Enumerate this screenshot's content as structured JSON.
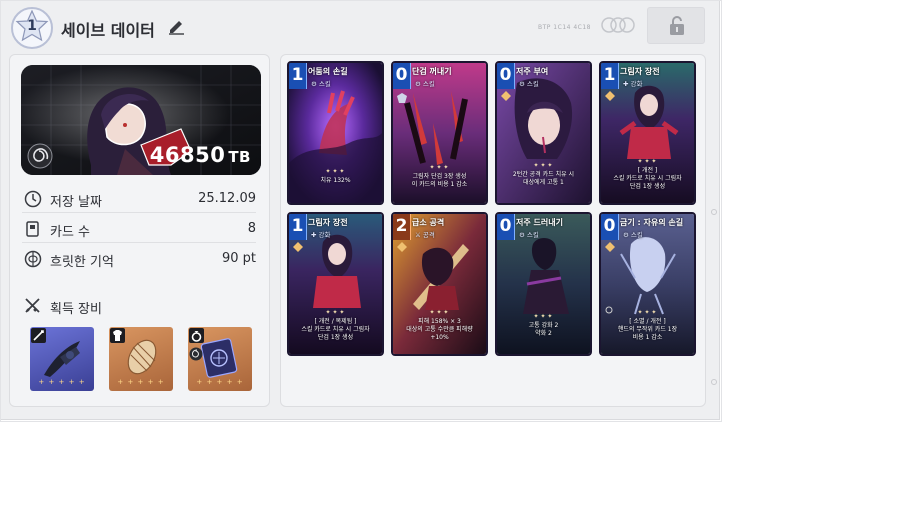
{
  "header": {
    "slot_number": "1",
    "title": "세이브 데이터",
    "faint_text": "BTP 1C14 4C18"
  },
  "profile": {
    "score": "46850",
    "score_unit": "TB",
    "stats": [
      {
        "label": "저장 날짜",
        "value": "25.12.09",
        "icon": "clock-icon"
      },
      {
        "label": "카드 수",
        "value": "8",
        "icon": "card-icon"
      },
      {
        "label": "흐릿한 기억",
        "value": "90 pt",
        "icon": "memory-icon"
      }
    ],
    "equipment_title": "획득 장비",
    "equipment": [
      {
        "name": "weapon",
        "icon": "sword-icon",
        "stars": "+ + + + +",
        "color": "#5b5fc7"
      },
      {
        "name": "armor",
        "icon": "shirt-icon",
        "stars": "+ + + + +",
        "color": "#c8814c"
      },
      {
        "name": "ring",
        "icon": "ring-icon",
        "stars": "+ + + + +",
        "color": "#c8814c"
      }
    ]
  },
  "cards": [
    {
      "cost": "1",
      "name": "어둠의 손길",
      "type": "스킬",
      "desc": [
        "치유 132%"
      ],
      "color": "#5a2a9c",
      "accent": "#c03050"
    },
    {
      "cost": "0",
      "name": "단검 꺼내기",
      "type": "스킬",
      "desc": [
        "그림자 단검 3장 생성",
        "이 카드의 비용 1 감소"
      ],
      "color": "#6a2d7a",
      "accent": "#d23a3a"
    },
    {
      "cost": "0",
      "name": "저주 부여",
      "type": "스킬",
      "desc": [
        "2턴간 공격 카드 치유 시",
        "대상에게 고통 1"
      ],
      "color": "#4b2a6e",
      "accent": "#b33060"
    },
    {
      "cost": "1",
      "name": "그림자 장전",
      "type": "강화",
      "desc": [
        "[ 개전 ]",
        "스킬 카드로 치유 시 그림자",
        "단검 1장 생성"
      ],
      "color": "#3e2766",
      "accent": "#c02a48"
    },
    {
      "cost": "1",
      "name": "그림자 장전",
      "type": "강화",
      "desc": [
        "[ 개전 / 복제됨 ]",
        "스킬 카드로 치유 시 그림자",
        "단검 1장 생성"
      ],
      "color": "#3a2560",
      "accent": "#c02a48"
    },
    {
      "cost": "2",
      "name": "급소 공격",
      "type": "공격",
      "desc": [
        "피해 158% × 3",
        "대상의 고통 수만큼 피해량",
        "+10%"
      ],
      "color": "#7a2a3a",
      "accent": "#e0a030"
    },
    {
      "cost": "0",
      "name": "저주 드러내기",
      "type": "스킬",
      "desc": [
        "고통 강화 2",
        "약화 2"
      ],
      "color": "#24324a",
      "accent": "#8a3aa0"
    },
    {
      "cost": "0",
      "name": "금기 : 자유의 손길",
      "type": "스킬",
      "desc": [
        "[ 소멸 / 개전 ]",
        "핸드의 무작위 카드 1장",
        "비용 1 감소"
      ],
      "color": "#3a3f66",
      "accent": "#a7b2e0"
    }
  ]
}
